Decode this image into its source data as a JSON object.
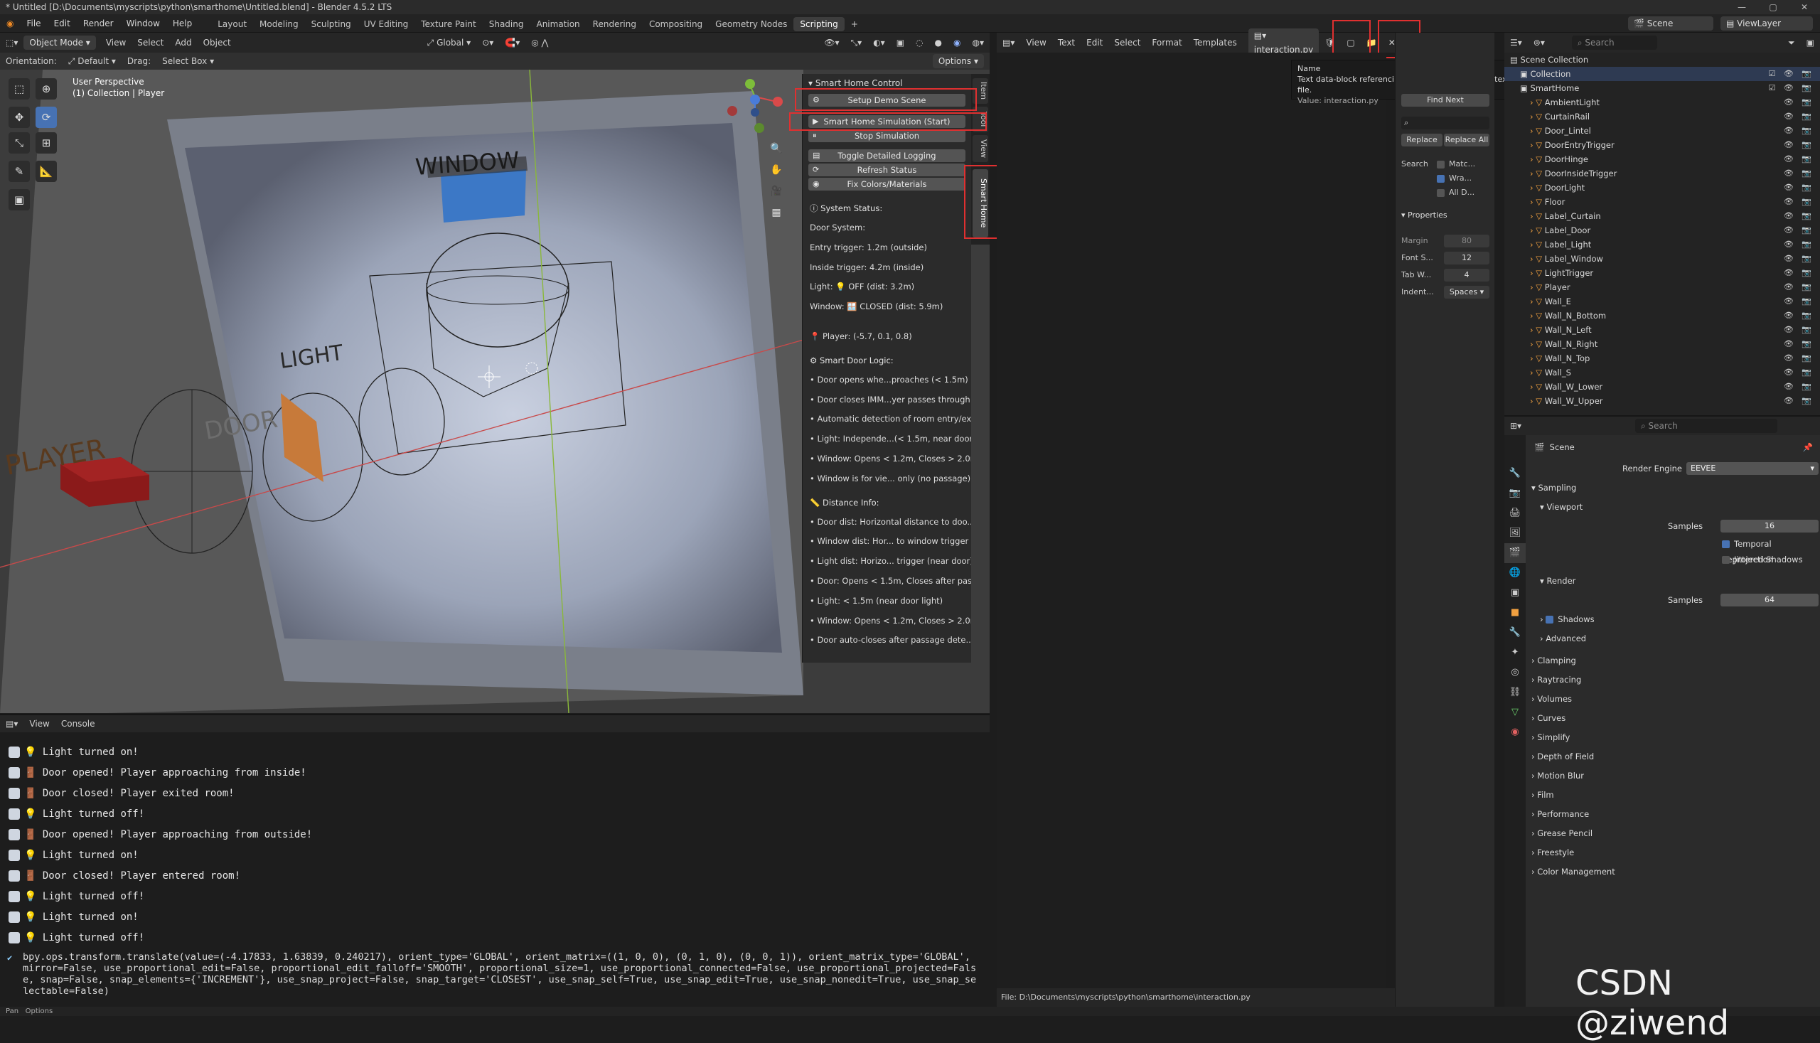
{
  "window": {
    "title": "* Untitled [D:\\Documents\\myscripts\\python\\smarthome\\Untitled.blend] - Blender 4.5.2 LTS"
  },
  "menubar": {
    "menus": [
      "File",
      "Edit",
      "Render",
      "Window",
      "Help"
    ],
    "workspaces": [
      "Layout",
      "Modeling",
      "Sculpting",
      "UV Editing",
      "Texture Paint",
      "Shading",
      "Animation",
      "Rendering",
      "Compositing",
      "Geometry Nodes",
      "Scripting"
    ],
    "active_workspace": "Scripting",
    "scene": "Scene",
    "view_layer": "ViewLayer"
  },
  "viewport": {
    "mode": "Object Mode",
    "menus": [
      "View",
      "Select",
      "Add",
      "Object"
    ],
    "transform_orientation": "Global",
    "orientation_label": "Orientation:",
    "orientation_value": "Default",
    "drag_label": "Drag:",
    "drag_value": "Select Box",
    "options": "Options",
    "overlay_title": "User Perspective",
    "overlay_sub": "(1) Collection | Player",
    "scene_labels": {
      "window": "WINDOW",
      "light": "LIGHT",
      "player": "PLAYER",
      "door": "DOOR"
    }
  },
  "npanel": {
    "title": "Smart Home Control",
    "buttons": [
      "Setup Demo Scene",
      "Smart Home Simulation (Start)",
      "Stop Simulation",
      "Toggle Detailed Logging",
      "Refresh Status",
      "Fix Colors/Materials"
    ],
    "status_title": "System Status:",
    "status_lines": [
      "Door System:",
      "Entry trigger: 1.2m (outside)",
      "Inside trigger: 4.2m (inside)",
      "Light: 💡 OFF (dist: 3.2m)",
      "Window: 🪟 CLOSED (dist: 5.9m)",
      "",
      "📍 Player: (-5.7, 0.1, 0.8)"
    ],
    "logic_title": "Smart Door Logic:",
    "logic_lines": [
      "• Door opens whe...proaches (< 1.5m)",
      "• Door closes IMM...yer passes through",
      "• Automatic detection of room entry/exit",
      "• Light: Independe...(< 1.5m, near door)",
      "• Window: Opens < 1.2m, Closes > 2.0m",
      "• Window is for vie... only (no passage)"
    ],
    "dist_title": "📏 Distance Info:",
    "dist_lines": [
      "• Door dist: Horizontal distance to doo...",
      "• Window dist: Hor... to window trigger",
      "• Light dist: Horizo... trigger (near door)",
      "• Door: Opens < 1.5m, Closes after pas...",
      "• Light: < 1.5m (near door light)",
      "• Window: Opens < 1.2m, Closes > 2.0m",
      "• Door auto-closes after passage dete..."
    ],
    "tabs": [
      "Item",
      "Tool",
      "View",
      "Smart Home"
    ]
  },
  "console": {
    "menus": [
      "View",
      "Console"
    ],
    "lines": [
      "Light turned on!",
      "Door opened! Player approaching from inside!",
      "Door closed! Player exited room!",
      "Light turned off!",
      "Door opened! Player approaching from outside!",
      "Light turned on!",
      "Door closed! Player entered room!",
      "Light turned off!",
      "Light turned on!",
      "Light turned off!"
    ],
    "last": "bpy.ops.transform.translate(value=(-4.17833, 1.63839, 0.240217), orient_type='GLOBAL', orient_matrix=((1, 0, 0), (0, 1, 0), (0, 0, 1)), orient_matrix_type='GLOBAL', mirror=False, use_proportional_edit=False, proportional_edit_falloff='SMOOTH', proportional_size=1, use_proportional_connected=False, use_proportional_projected=False, snap=False, snap_elements={'INCREMENT'}, use_snap_project=False, snap_target='CLOSEST', use_snap_self=True, use_snap_edit=True, use_snap_nonedit=True, use_snap_selectable=False)"
  },
  "statusbar": {
    "left": "Pan",
    "mid": "Options"
  },
  "text_editor": {
    "menus": [
      "View",
      "Text",
      "Edit",
      "Select",
      "Format",
      "Templates"
    ],
    "filename": "interaction.py",
    "footer": "File: D:\\Documents\\myscripts\\python\\smarthome\\interaction.py",
    "tooltip": {
      "name": "Name",
      "desc": "Text data-block referencing an external or packed text file.",
      "value": "Value: interaction.py"
    },
    "find_next": "Find Next",
    "replace": "Replace",
    "replace_all": "Replace All",
    "search_label": "Search",
    "match_case": "Matc...",
    "wrap": "Wra...",
    "all_data": "All D...",
    "properties_title": "Properties",
    "margin_label": "Margin",
    "margin_value": "80",
    "font_size_label": "Font S...",
    "font_size_value": "12",
    "tab_width_label": "Tab W...",
    "tab_width_value": "4",
    "indent_label": "Indent...",
    "indent_value": "Spaces"
  },
  "outliner": {
    "search_placeholder": "Search",
    "root": "Scene Collection",
    "items": [
      {
        "name": "Collection",
        "level": 0
      },
      {
        "name": "SmartHome",
        "level": 0
      },
      {
        "name": "AmbientLight",
        "level": 1
      },
      {
        "name": "CurtainRail",
        "level": 1
      },
      {
        "name": "Door_Lintel",
        "level": 1
      },
      {
        "name": "DoorEntryTrigger",
        "level": 1
      },
      {
        "name": "DoorHinge",
        "level": 1
      },
      {
        "name": "DoorInsideTrigger",
        "level": 1
      },
      {
        "name": "DoorLight",
        "level": 1
      },
      {
        "name": "Floor",
        "level": 1
      },
      {
        "name": "Label_Curtain",
        "level": 1
      },
      {
        "name": "Label_Door",
        "level": 1
      },
      {
        "name": "Label_Light",
        "level": 1
      },
      {
        "name": "Label_Window",
        "level": 1
      },
      {
        "name": "LightTrigger",
        "level": 1
      },
      {
        "name": "Player",
        "level": 1
      },
      {
        "name": "Wall_E",
        "level": 1
      },
      {
        "name": "Wall_N_Bottom",
        "level": 1
      },
      {
        "name": "Wall_N_Left",
        "level": 1
      },
      {
        "name": "Wall_N_Right",
        "level": 1
      },
      {
        "name": "Wall_N_Top",
        "level": 1
      },
      {
        "name": "Wall_S",
        "level": 1
      },
      {
        "name": "Wall_W_Lower",
        "level": 1
      },
      {
        "name": "Wall_W_Upper",
        "level": 1
      }
    ]
  },
  "properties": {
    "search_placeholder": "Search",
    "context": "Scene",
    "render_engine_label": "Render Engine",
    "render_engine": "EEVEE",
    "sampling": "Sampling",
    "viewport": "Viewport",
    "samples_label": "Samples",
    "viewport_samples": "16",
    "temporal": "Temporal Reprojection",
    "jittered": "Jittered Shadows",
    "render": "Render",
    "render_samples": "64",
    "shadows": "Shadows",
    "advanced": "Advanced",
    "panels": [
      "Clamping",
      "Raytracing",
      "Volumes",
      "Curves",
      "Simplify",
      "Depth of Field",
      "Motion Blur",
      "Film",
      "Performance",
      "Grease Pencil",
      "Freestyle",
      "Color Management"
    ]
  },
  "watermark": "CSDN @ziwend"
}
